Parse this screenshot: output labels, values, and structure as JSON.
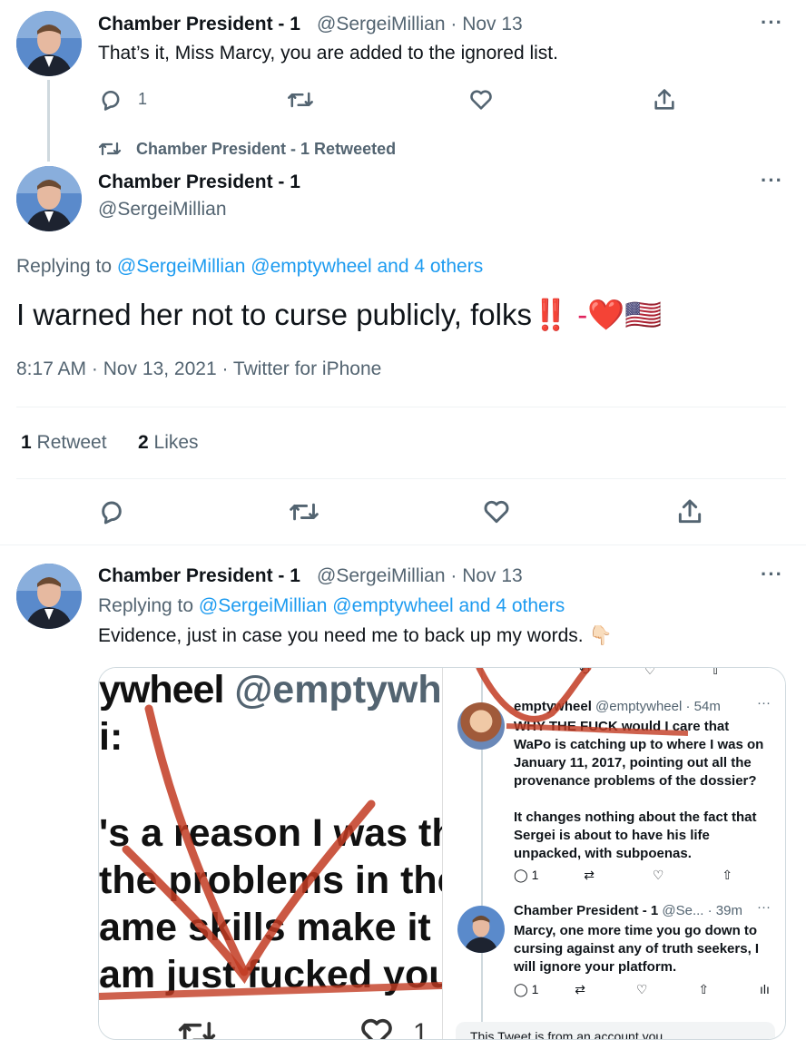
{
  "tweet1": {
    "name": "Chamber President - 1",
    "handle_date": "@SergeiMillian · Nov 13",
    "text": "That’s it, Miss Marcy, you are added to the ignored list.",
    "reply_count": "1"
  },
  "retweet_banner": "Chamber President - 1 Retweeted",
  "main_tweet": {
    "name": "Chamber President - 1",
    "handle": "@SergeiMillian",
    "replying_prefix": "Replying to ",
    "replying_to": "@SergeiMillian @emptywheel and 4 others",
    "text": "I warned her not to curse publicly, folks",
    "emoji_suffix": "‼️ -❤️🇺🇸",
    "meta": "8:17 AM · Nov 13, 2021 · Twitter for iPhone",
    "retweet_count": "1",
    "retweet_label": "Retweet",
    "like_count": "2",
    "like_label": "Likes"
  },
  "tweet3": {
    "name": "Chamber President - 1",
    "handle_date": "@SergeiMillian · Nov 13",
    "replying_prefix": "Replying to ",
    "replying_to": "@SergeiMillian @emptywheel and 4 others",
    "text": "Evidence, just in case you need me to back up my words.",
    "emoji": "👇🏻"
  },
  "embedded_left": {
    "line1_name": "ywheel",
    "line1_handle": "@emptywhe",
    "line2": "i:",
    "line3": "'s a reason I was the",
    "line4": "the problems in the",
    "line5": "ame skills make it cle",
    "line6": "am just fucked you.",
    "bottom_count": "1"
  },
  "embedded_right": {
    "t1_name": "emptywheel",
    "t1_meta": "@emptywheel · 54m",
    "t1_line1": "WHY THE FUCK would I care that",
    "t1_line2": "WaPo is catching up to where I was on",
    "t1_line3": "January 11, 2017, pointing out all the",
    "t1_line4": "provenance problems of the dossier?",
    "t1_line5": "It changes nothing about the fact that",
    "t1_line6": "Sergei is about to have his life",
    "t1_line7": "unpacked, with subpoenas.",
    "t1_reply_count": "1",
    "t2_name": "Chamber President - 1",
    "t2_meta": "@Se... · 39m",
    "t2_line1": "Marcy, one more time you go down to",
    "t2_line2": "cursing against any of truth seekers, I",
    "t2_line3": "will ignore your platform.",
    "t2_reply_count": "1",
    "footer": "This Tweet is from an account you"
  },
  "colors": {
    "link": "#1d9bf0",
    "muted": "#536471",
    "divider": "#eff3f4",
    "ink": "#c23b22"
  }
}
